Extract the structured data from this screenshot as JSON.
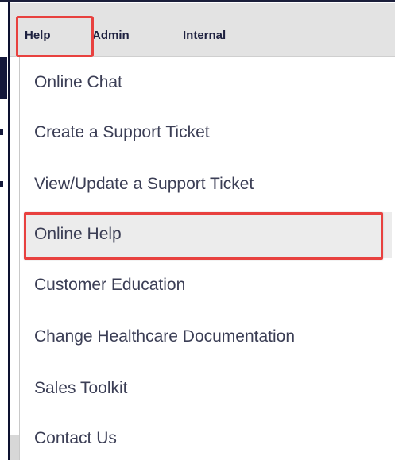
{
  "menubar": {
    "items": [
      {
        "label": "Help"
      },
      {
        "label": "Admin"
      },
      {
        "label": "Internal"
      }
    ]
  },
  "dropdown": {
    "items": [
      {
        "label": "Online Chat"
      },
      {
        "label": "Create a Support Ticket"
      },
      {
        "label": "View/Update a Support Ticket"
      },
      {
        "label": "Online Help"
      },
      {
        "label": "Customer Education"
      },
      {
        "label": "Change Healthcare Documentation"
      },
      {
        "label": "Sales Toolkit"
      },
      {
        "label": "Contact Us"
      }
    ]
  },
  "colors": {
    "highlight": "#e8413f",
    "menubar_bg": "#e3e3e3",
    "menu_text": "#1e2140",
    "item_text": "#3b3e55"
  }
}
